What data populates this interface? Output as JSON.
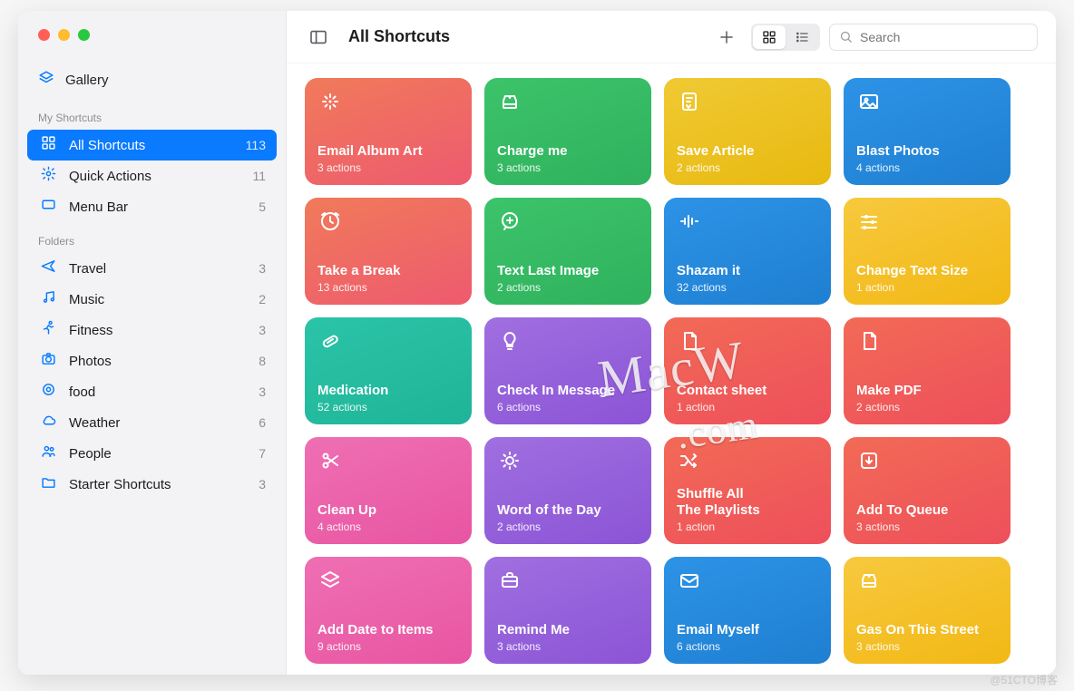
{
  "header": {
    "title": "All Shortcuts",
    "search_placeholder": "Search"
  },
  "gallery_label": "Gallery",
  "sections": {
    "my_shortcuts_label": "My Shortcuts",
    "folders_label": "Folders"
  },
  "sidebar": {
    "shortcuts": [
      {
        "icon": "grid",
        "label": "All Shortcuts",
        "count": "113",
        "selected": true
      },
      {
        "icon": "gear",
        "label": "Quick Actions",
        "count": "11",
        "selected": false
      },
      {
        "icon": "rect",
        "label": "Menu Bar",
        "count": "5",
        "selected": false
      }
    ],
    "folders": [
      {
        "icon": "plane",
        "label": "Travel",
        "count": "3"
      },
      {
        "icon": "music",
        "label": "Music",
        "count": "2"
      },
      {
        "icon": "run",
        "label": "Fitness",
        "count": "3"
      },
      {
        "icon": "camera",
        "label": "Photos",
        "count": "8"
      },
      {
        "icon": "target",
        "label": "food",
        "count": "3"
      },
      {
        "icon": "cloud",
        "label": "Weather",
        "count": "6"
      },
      {
        "icon": "people",
        "label": "People",
        "count": "7"
      },
      {
        "icon": "folder",
        "label": "Starter Shortcuts",
        "count": "3"
      }
    ]
  },
  "cards": [
    {
      "icon": "sparkle",
      "title": "Email Album Art",
      "sub": "3 actions",
      "grad": [
        "#f07a5a",
        "#ee5a6f"
      ]
    },
    {
      "icon": "car",
      "title": "Charge me",
      "sub": "3 actions",
      "grad": [
        "#3cc46a",
        "#2fb15d"
      ]
    },
    {
      "icon": "doc-lang",
      "title": "Save Article",
      "sub": "2 actions",
      "grad": [
        "#f0c934",
        "#e8b90f"
      ]
    },
    {
      "icon": "image",
      "title": "Blast Photos",
      "sub": "4 actions",
      "grad": [
        "#2d93e6",
        "#1f7fd1"
      ]
    },
    {
      "icon": "clock",
      "title": "Take a Break",
      "sub": "13 actions",
      "grad": [
        "#f07a5a",
        "#ee5a6f"
      ]
    },
    {
      "icon": "plus-bubble",
      "title": "Text Last Image",
      "sub": "2 actions",
      "grad": [
        "#3cc46a",
        "#2fb15d"
      ]
    },
    {
      "icon": "wave",
      "title": "Shazam it",
      "sub": "32 actions",
      "grad": [
        "#2d93e6",
        "#1f7fd1"
      ]
    },
    {
      "icon": "sliders",
      "title": "Change Text Size",
      "sub": "1 action",
      "grad": [
        "#f7c93e",
        "#f2b814"
      ]
    },
    {
      "icon": "pill",
      "title": "Medication",
      "sub": "52 actions",
      "grad": [
        "#2bc4a8",
        "#1fb498"
      ]
    },
    {
      "icon": "bulb",
      "title": "Check In Message",
      "sub": "6 actions",
      "grad": [
        "#a06fe0",
        "#8b54d6"
      ]
    },
    {
      "icon": "doc",
      "title": "Contact sheet",
      "sub": "1 action",
      "grad": [
        "#f26a56",
        "#ee4f5b"
      ]
    },
    {
      "icon": "doc",
      "title": "Make PDF",
      "sub": "2 actions",
      "grad": [
        "#f26a56",
        "#ee4f5b"
      ]
    },
    {
      "icon": "scissors",
      "title": "Clean Up",
      "sub": "4 actions",
      "grad": [
        "#ef6fb3",
        "#e855a2"
      ]
    },
    {
      "icon": "sun",
      "title": "Word of the Day",
      "sub": "2 actions",
      "grad": [
        "#a06fe0",
        "#8b54d6"
      ]
    },
    {
      "icon": "shuffle",
      "title": "Shuffle All\nThe Playlists",
      "sub": "1 action",
      "grad": [
        "#f26a56",
        "#ee4f5b"
      ]
    },
    {
      "icon": "download",
      "title": "Add To Queue",
      "sub": "3 actions",
      "grad": [
        "#f26a56",
        "#ee4f5b"
      ]
    },
    {
      "icon": "layers",
      "title": "Add Date to Items",
      "sub": "9 actions",
      "grad": [
        "#ef6fb3",
        "#e855a2"
      ]
    },
    {
      "icon": "briefcase",
      "title": "Remind Me",
      "sub": "3 actions",
      "grad": [
        "#a06fe0",
        "#8b54d6"
      ]
    },
    {
      "icon": "mail",
      "title": "Email Myself",
      "sub": "6 actions",
      "grad": [
        "#2d93e6",
        "#1f7fd1"
      ]
    },
    {
      "icon": "car",
      "title": "Gas On This Street",
      "sub": "3 actions",
      "grad": [
        "#f7c93e",
        "#f2b814"
      ]
    }
  ],
  "watermark": {
    "line1": "MacW",
    "line2": ".com"
  },
  "footer": "@51CTO博客"
}
